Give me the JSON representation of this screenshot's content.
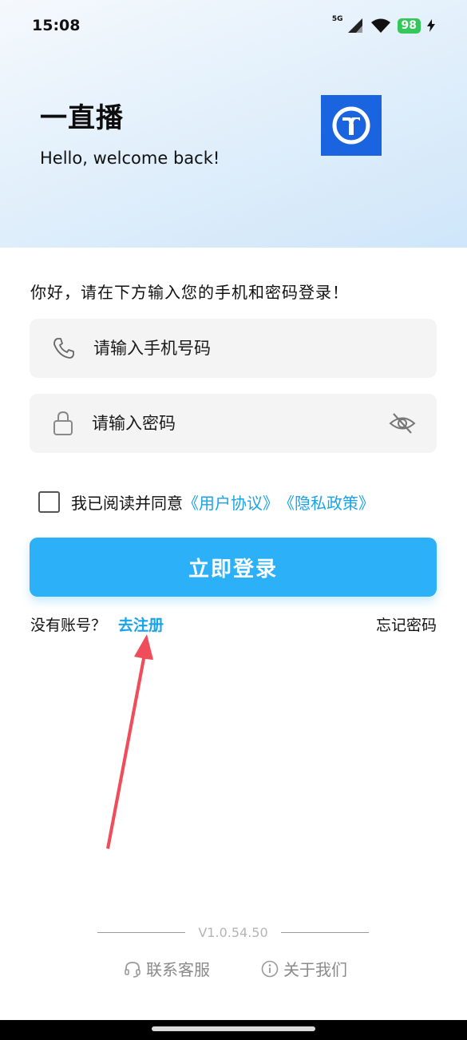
{
  "status_bar": {
    "time": "15:08",
    "network": "5G",
    "battery": "98"
  },
  "header": {
    "app_name": "一直播",
    "welcome": "Hello, welcome back!"
  },
  "form": {
    "greeting": "你好，请在下方输入您的手机和密码登录！",
    "phone_placeholder": "请输入手机号码",
    "password_placeholder": "请输入密码",
    "agree_prefix": "我已阅读并同意",
    "user_agreement": "《用户协议》",
    "privacy_policy": "《隐私政策》",
    "login_button": "立即登录",
    "no_account": "没有账号？",
    "register": "去注册",
    "forgot_password": "忘记密码"
  },
  "footer": {
    "version": "V1.0.54.50",
    "contact": "联系客服",
    "about": "关于我们"
  },
  "colors": {
    "accent": "#2cb0f7",
    "link": "#1aa3e8",
    "logo_bg": "#1b64e0",
    "annotation_arrow": "#ef4d5a"
  },
  "icons": [
    "phone-icon",
    "lock-icon",
    "eye-off-icon",
    "headset-icon",
    "info-icon",
    "app-logo-icon",
    "wifi-icon",
    "signal-icon",
    "bolt-icon"
  ]
}
